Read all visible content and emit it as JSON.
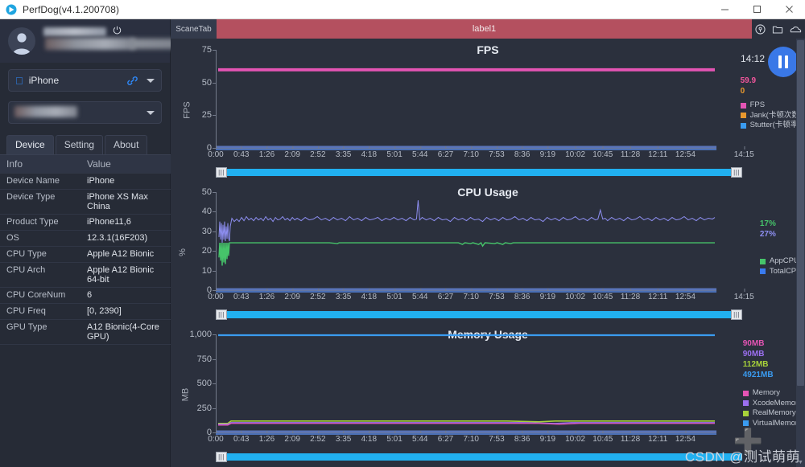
{
  "window": {
    "title": "PerfDog(v4.1.200708)",
    "logo_icon": "perfdog-logo-icon",
    "minimize_label": "—",
    "maximize_label": "□",
    "close_label": "✕"
  },
  "sidebar": {
    "user": {
      "name_redacted": true,
      "name_suffix": "m",
      "power_icon": "power-icon",
      "avatar_icon": "user-avatar-icon"
    },
    "device_select": {
      "platform_icon": "apple-icon",
      "value": "iPhone",
      "link_icon": "usb-link-icon",
      "caret_icon": "chevron-down-icon"
    },
    "app_select": {
      "value": "",
      "redacted": true,
      "caret_icon": "chevron-down-icon"
    },
    "tabs": [
      {
        "label": "Device",
        "active": true
      },
      {
        "label": "Setting",
        "active": false
      },
      {
        "label": "About",
        "active": false
      }
    ],
    "table": {
      "headers": [
        "Info",
        "Value"
      ],
      "rows": [
        {
          "info": "Device Name",
          "value": "iPhone"
        },
        {
          "info": "Device Type",
          "value": "iPhone XS Max China"
        },
        {
          "info": "Product Type",
          "value": "iPhone11,6"
        },
        {
          "info": "OS",
          "value": "12.3.1(16F203)"
        },
        {
          "info": "CPU Type",
          "value": "Apple A12 Bionic"
        },
        {
          "info": "CPU Arch",
          "value": "Apple A12 Bionic 64-bit"
        },
        {
          "info": "CPU CoreNum",
          "value": "6"
        },
        {
          "info": "CPU Freq",
          "value": "[0, 2390]"
        },
        {
          "info": "GPU Type",
          "value": "A12 Bionic(4-Core GPU)"
        }
      ]
    }
  },
  "content": {
    "scane_tab_label": "ScaneTab",
    "label_bar_text": "label1",
    "label_bar_color": "#b4505f",
    "toolbar_icons": [
      {
        "name": "location-pin-icon"
      },
      {
        "name": "folder-icon"
      },
      {
        "name": "cloud-icon"
      }
    ],
    "clock": "14:12",
    "pause_button": "pause-button",
    "accent_color": "#3a78e7",
    "scrollbar_color": "#21b0f0"
  },
  "chart_data": [
    {
      "type": "line",
      "title": "FPS",
      "ylabel": "FPS",
      "xlabel": "",
      "ylim": [
        0,
        75
      ],
      "yticks": [
        0,
        25,
        50,
        75
      ],
      "ytick_labels": [
        "0",
        "25",
        "50",
        "75"
      ],
      "xticks": [
        "0:00",
        "0:43",
        "1:26",
        "2:09",
        "2:52",
        "3:35",
        "4:18",
        "5:01",
        "5:44",
        "6:27",
        "7:10",
        "7:53",
        "8:36",
        "9:19",
        "10:02",
        "10:45",
        "11:28",
        "12:11",
        "12:54",
        "14:15"
      ],
      "grid": false,
      "legend_position": "right",
      "readouts": [
        {
          "value": "59.9",
          "color": "#f0559b"
        },
        {
          "value": "0",
          "color": "#e8982e"
        }
      ],
      "series": [
        {
          "name": "FPS",
          "color": "#e454b4",
          "mean": 59.9,
          "values": [
            59.9,
            60,
            59.9,
            60,
            59.9,
            60,
            59.9,
            60,
            59.9,
            60,
            59.9,
            60,
            59.9,
            60,
            59.9,
            60,
            59.9,
            60,
            59.9,
            60
          ]
        },
        {
          "name": "Jank(卡顿次数)",
          "color": "#e8982e",
          "mean": 0,
          "values": [
            0,
            0,
            0,
            0,
            0,
            0,
            0,
            0,
            0,
            0,
            0,
            0,
            0,
            0,
            0,
            0,
            0,
            0,
            0,
            0
          ]
        },
        {
          "name": "Stutter(卡顿率)",
          "color": "#3a9bf0",
          "mean": 0,
          "values": [
            0,
            0,
            0,
            0,
            0,
            0,
            0,
            0,
            0,
            0,
            0,
            0,
            0,
            0,
            0,
            0,
            0,
            0,
            0,
            0
          ]
        }
      ]
    },
    {
      "type": "line",
      "title": "CPU Usage",
      "ylabel": "%",
      "xlabel": "",
      "ylim": [
        0,
        50
      ],
      "yticks": [
        0,
        10,
        20,
        30,
        40,
        50
      ],
      "ytick_labels": [
        "0",
        "10",
        "20",
        "30",
        "40",
        "50"
      ],
      "xticks": [
        "0:00",
        "0:43",
        "1:26",
        "2:09",
        "2:52",
        "3:35",
        "4:18",
        "5:01",
        "5:44",
        "6:27",
        "7:10",
        "7:53",
        "8:36",
        "9:19",
        "10:02",
        "10:45",
        "11:28",
        "12:11",
        "12:54",
        "14:15"
      ],
      "grid": false,
      "legend_position": "right",
      "readouts": [
        {
          "value": "17%",
          "color": "#46c46a"
        },
        {
          "value": "27%",
          "color": "#8d8ef0"
        }
      ],
      "series": [
        {
          "name": "AppCPU",
          "color": "#46c46a",
          "mean": 17,
          "values": [
            17,
            17,
            17,
            17,
            17,
            17,
            17,
            17,
            17,
            17,
            17,
            17,
            17,
            17,
            17,
            17,
            17,
            17,
            17,
            17
          ]
        },
        {
          "name": "TotalCPU",
          "color": "#8d8ef0",
          "mean": 27,
          "values": [
            27,
            27,
            28,
            27,
            27,
            28,
            27,
            27,
            28,
            27,
            27,
            28,
            27,
            27,
            28,
            27,
            27,
            28,
            27,
            27
          ]
        }
      ]
    },
    {
      "type": "line",
      "title": "Memory Usage",
      "ylabel": "MB",
      "xlabel": "",
      "ylim": [
        0,
        1000
      ],
      "yticks": [
        0,
        250,
        500,
        750,
        1000
      ],
      "ytick_labels": [
        "0",
        "250",
        "500",
        "750",
        "1,000"
      ],
      "xticks": [
        "0:00",
        "0:43",
        "1:26",
        "2:09",
        "2:52",
        "3:35",
        "4:18",
        "5:01",
        "5:44",
        "6:27",
        "7:10",
        "7:53",
        "8:36",
        "9:19",
        "10:02",
        "10:45",
        "11:28",
        "12:11",
        "12:54"
      ],
      "grid": false,
      "legend_position": "right",
      "readouts": [
        {
          "value": "90MB",
          "color": "#e454b4"
        },
        {
          "value": "90MB",
          "color": "#9b6ff0"
        },
        {
          "value": "112MB",
          "color": "#a8d23a"
        },
        {
          "value": "4921MB",
          "color": "#3a9bf0"
        }
      ],
      "series": [
        {
          "name": "Memory",
          "color": "#e454b4",
          "mean": 90,
          "values": [
            78,
            90,
            90,
            90,
            90,
            90,
            90,
            90,
            90,
            90,
            90,
            90,
            90,
            90,
            90,
            90,
            90,
            90,
            90,
            90
          ]
        },
        {
          "name": "XcodeMemory",
          "color": "#9b6ff0",
          "mean": 90,
          "values": [
            78,
            90,
            90,
            90,
            90,
            90,
            90,
            90,
            90,
            90,
            90,
            90,
            90,
            90,
            90,
            90,
            90,
            90,
            90,
            90
          ]
        },
        {
          "name": "RealMemory",
          "color": "#a8d23a",
          "mean": 112,
          "values": [
            82,
            112,
            112,
            112,
            112,
            112,
            112,
            112,
            112,
            112,
            112,
            112,
            112,
            112,
            112,
            112,
            112,
            112,
            112,
            112
          ]
        },
        {
          "name": "VirtualMemory",
          "color": "#3a9bf0",
          "mean": 4921,
          "values": [
            995,
            1000,
            1000,
            1000,
            1000,
            1000,
            1000,
            1000,
            1000,
            1000,
            1000,
            1000,
            1000,
            1000,
            1000,
            1000,
            1000,
            1000,
            1000,
            1000
          ]
        }
      ]
    }
  ],
  "watermark": "CSDN @测试萌萌"
}
